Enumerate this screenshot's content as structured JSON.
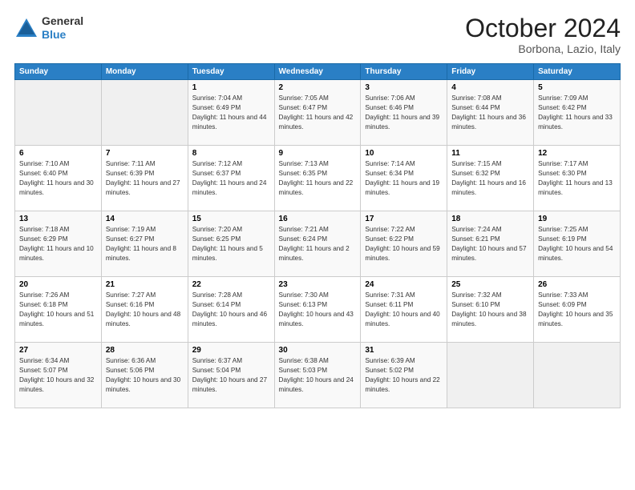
{
  "header": {
    "logo_general": "General",
    "logo_blue": "Blue",
    "month": "October 2024",
    "location": "Borbona, Lazio, Italy"
  },
  "days_of_week": [
    "Sunday",
    "Monday",
    "Tuesday",
    "Wednesday",
    "Thursday",
    "Friday",
    "Saturday"
  ],
  "weeks": [
    [
      {
        "day": "",
        "info": ""
      },
      {
        "day": "",
        "info": ""
      },
      {
        "day": "1",
        "info": "Sunrise: 7:04 AM\nSunset: 6:49 PM\nDaylight: 11 hours and 44 minutes."
      },
      {
        "day": "2",
        "info": "Sunrise: 7:05 AM\nSunset: 6:47 PM\nDaylight: 11 hours and 42 minutes."
      },
      {
        "day": "3",
        "info": "Sunrise: 7:06 AM\nSunset: 6:46 PM\nDaylight: 11 hours and 39 minutes."
      },
      {
        "day": "4",
        "info": "Sunrise: 7:08 AM\nSunset: 6:44 PM\nDaylight: 11 hours and 36 minutes."
      },
      {
        "day": "5",
        "info": "Sunrise: 7:09 AM\nSunset: 6:42 PM\nDaylight: 11 hours and 33 minutes."
      }
    ],
    [
      {
        "day": "6",
        "info": "Sunrise: 7:10 AM\nSunset: 6:40 PM\nDaylight: 11 hours and 30 minutes."
      },
      {
        "day": "7",
        "info": "Sunrise: 7:11 AM\nSunset: 6:39 PM\nDaylight: 11 hours and 27 minutes."
      },
      {
        "day": "8",
        "info": "Sunrise: 7:12 AM\nSunset: 6:37 PM\nDaylight: 11 hours and 24 minutes."
      },
      {
        "day": "9",
        "info": "Sunrise: 7:13 AM\nSunset: 6:35 PM\nDaylight: 11 hours and 22 minutes."
      },
      {
        "day": "10",
        "info": "Sunrise: 7:14 AM\nSunset: 6:34 PM\nDaylight: 11 hours and 19 minutes."
      },
      {
        "day": "11",
        "info": "Sunrise: 7:15 AM\nSunset: 6:32 PM\nDaylight: 11 hours and 16 minutes."
      },
      {
        "day": "12",
        "info": "Sunrise: 7:17 AM\nSunset: 6:30 PM\nDaylight: 11 hours and 13 minutes."
      }
    ],
    [
      {
        "day": "13",
        "info": "Sunrise: 7:18 AM\nSunset: 6:29 PM\nDaylight: 11 hours and 10 minutes."
      },
      {
        "day": "14",
        "info": "Sunrise: 7:19 AM\nSunset: 6:27 PM\nDaylight: 11 hours and 8 minutes."
      },
      {
        "day": "15",
        "info": "Sunrise: 7:20 AM\nSunset: 6:25 PM\nDaylight: 11 hours and 5 minutes."
      },
      {
        "day": "16",
        "info": "Sunrise: 7:21 AM\nSunset: 6:24 PM\nDaylight: 11 hours and 2 minutes."
      },
      {
        "day": "17",
        "info": "Sunrise: 7:22 AM\nSunset: 6:22 PM\nDaylight: 10 hours and 59 minutes."
      },
      {
        "day": "18",
        "info": "Sunrise: 7:24 AM\nSunset: 6:21 PM\nDaylight: 10 hours and 57 minutes."
      },
      {
        "day": "19",
        "info": "Sunrise: 7:25 AM\nSunset: 6:19 PM\nDaylight: 10 hours and 54 minutes."
      }
    ],
    [
      {
        "day": "20",
        "info": "Sunrise: 7:26 AM\nSunset: 6:18 PM\nDaylight: 10 hours and 51 minutes."
      },
      {
        "day": "21",
        "info": "Sunrise: 7:27 AM\nSunset: 6:16 PM\nDaylight: 10 hours and 48 minutes."
      },
      {
        "day": "22",
        "info": "Sunrise: 7:28 AM\nSunset: 6:14 PM\nDaylight: 10 hours and 46 minutes."
      },
      {
        "day": "23",
        "info": "Sunrise: 7:30 AM\nSunset: 6:13 PM\nDaylight: 10 hours and 43 minutes."
      },
      {
        "day": "24",
        "info": "Sunrise: 7:31 AM\nSunset: 6:11 PM\nDaylight: 10 hours and 40 minutes."
      },
      {
        "day": "25",
        "info": "Sunrise: 7:32 AM\nSunset: 6:10 PM\nDaylight: 10 hours and 38 minutes."
      },
      {
        "day": "26",
        "info": "Sunrise: 7:33 AM\nSunset: 6:09 PM\nDaylight: 10 hours and 35 minutes."
      }
    ],
    [
      {
        "day": "27",
        "info": "Sunrise: 6:34 AM\nSunset: 5:07 PM\nDaylight: 10 hours and 32 minutes."
      },
      {
        "day": "28",
        "info": "Sunrise: 6:36 AM\nSunset: 5:06 PM\nDaylight: 10 hours and 30 minutes."
      },
      {
        "day": "29",
        "info": "Sunrise: 6:37 AM\nSunset: 5:04 PM\nDaylight: 10 hours and 27 minutes."
      },
      {
        "day": "30",
        "info": "Sunrise: 6:38 AM\nSunset: 5:03 PM\nDaylight: 10 hours and 24 minutes."
      },
      {
        "day": "31",
        "info": "Sunrise: 6:39 AM\nSunset: 5:02 PM\nDaylight: 10 hours and 22 minutes."
      },
      {
        "day": "",
        "info": ""
      },
      {
        "day": "",
        "info": ""
      }
    ]
  ]
}
